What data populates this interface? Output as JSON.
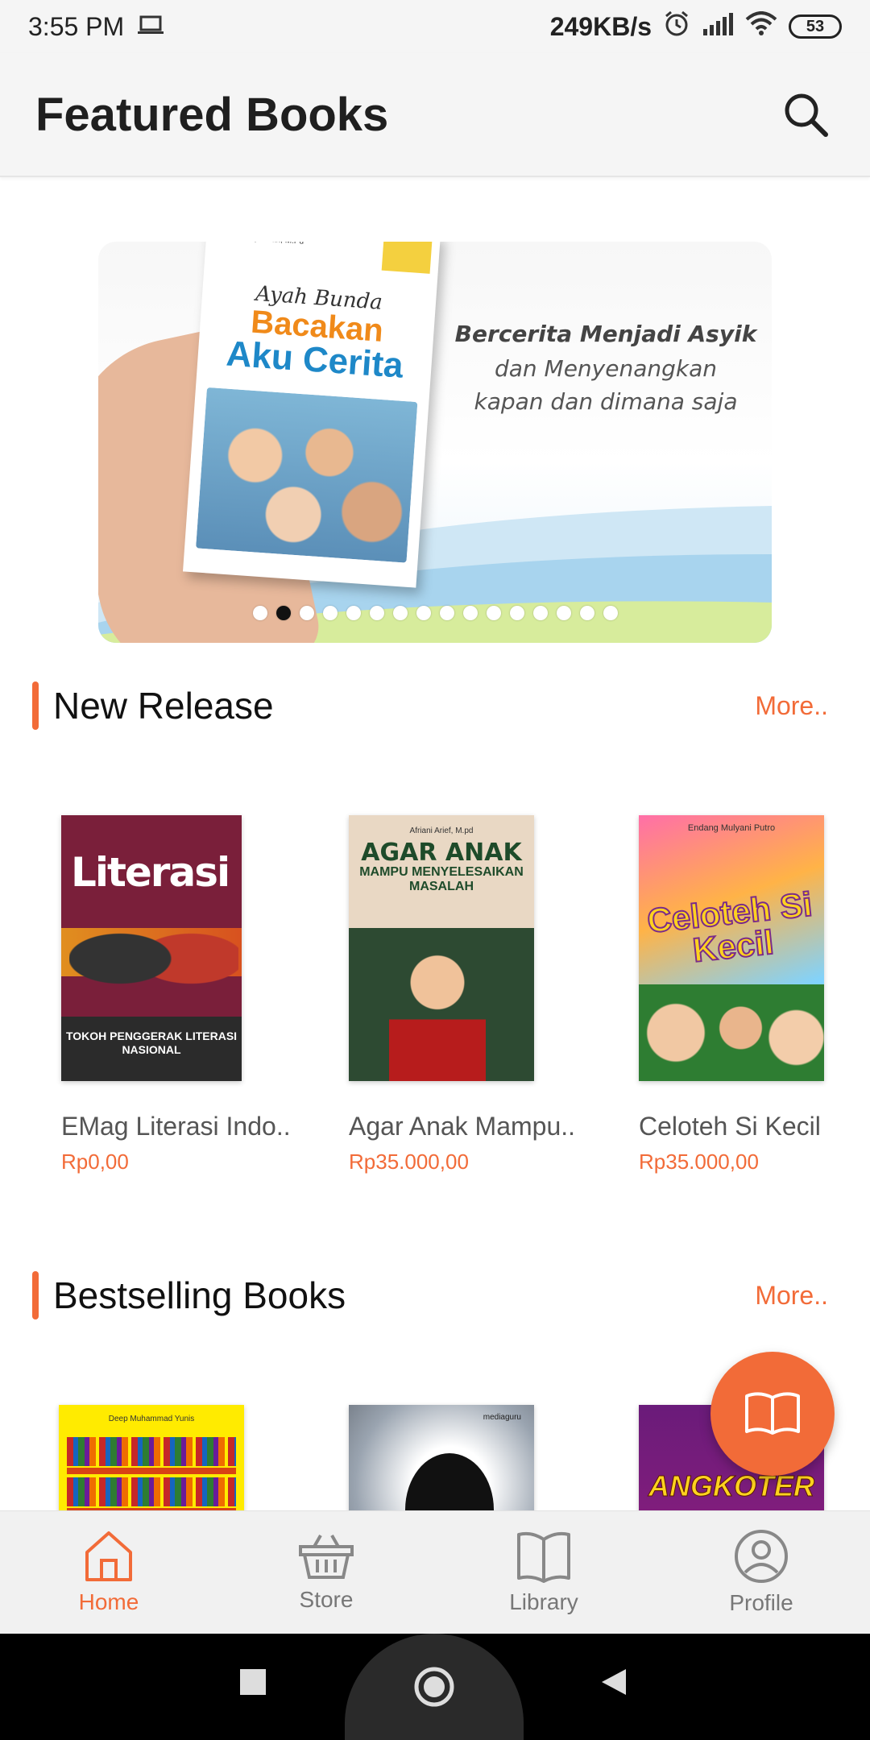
{
  "status_bar": {
    "time": "3:55 PM",
    "network_speed": "249KB/s",
    "battery": "53",
    "icons": [
      "laptop-icon",
      "alarm-icon",
      "signal-icon",
      "wifi-icon",
      "battery-icon"
    ]
  },
  "header": {
    "title": "Featured Books",
    "search_icon": "search-icon"
  },
  "banner": {
    "book": {
      "author": "Wiwik Puspitasari, M.Pd",
      "title_line1": "Ayah Bunda",
      "title_line2": "Bacakan",
      "title_line3": "Aku Cerita"
    },
    "tagline_line1": "Bercerita Menjadi Asyik",
    "tagline_line2": "dan Menyenangkan",
    "tagline_line3": "kapan dan dimana saja",
    "dot_count": 16,
    "active_dot": 1
  },
  "sections": {
    "new_release": {
      "title": "New Release",
      "more_label": "More..",
      "books": [
        {
          "title": "EMag Literasi Indo..",
          "price": "Rp0,00",
          "cover_text": "Literasi",
          "cover_footer": "TOKOH PENGGERAK LITERASI NASIONAL"
        },
        {
          "title": "Agar Anak Mampu..",
          "price": "Rp35.000,00",
          "cover_author": "Afriani Arief, M.pd",
          "cover_title": "AGAR ANAK",
          "cover_subtitle": "MAMPU MENYELESAIKAN MASALAH"
        },
        {
          "title": "Celoteh Si Kecil",
          "price": "Rp35.000,00",
          "cover_author": "Endang Mulyani Putro",
          "cover_title": "Celoteh Si Kecil"
        }
      ]
    },
    "bestselling": {
      "title": "Bestselling Books",
      "more_label": "More..",
      "books": [
        {
          "cover_author": "Deep Muhammad Yunis"
        },
        {
          "cover_logo": "mediaguru"
        },
        {
          "cover_title": "ANGKOTER"
        }
      ]
    }
  },
  "fab": {
    "icon": "open-book-icon"
  },
  "bottom_nav": {
    "items": [
      {
        "label": "Home",
        "icon": "home-icon",
        "active": true
      },
      {
        "label": "Store",
        "icon": "basket-icon",
        "active": false
      },
      {
        "label": "Library",
        "icon": "book-icon",
        "active": false
      },
      {
        "label": "Profile",
        "icon": "profile-icon",
        "active": false
      }
    ]
  },
  "colors": {
    "accent": "#f26b38",
    "text_primary": "#111111",
    "text_secondary": "#555555",
    "nav_inactive": "#777777"
  }
}
